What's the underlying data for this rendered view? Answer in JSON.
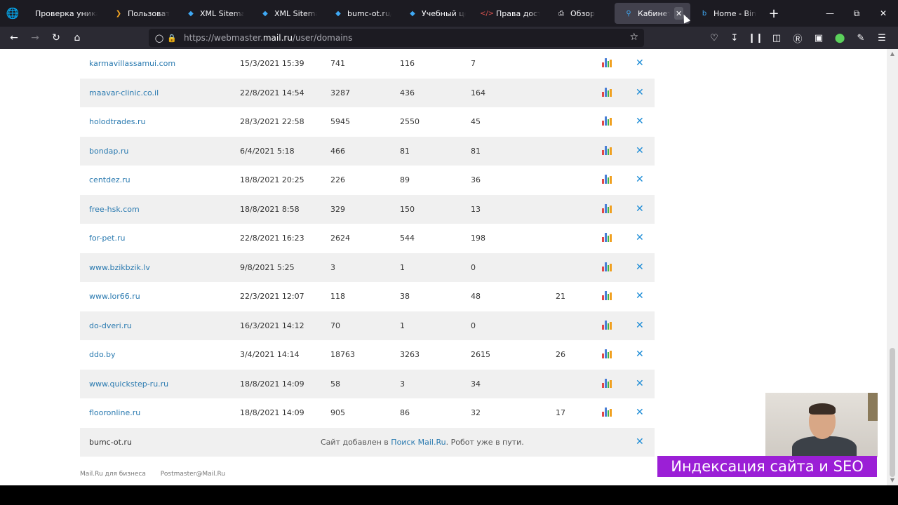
{
  "browser": {
    "tabs": [
      {
        "label": "Проверка уникаль",
        "icon": "none",
        "color": "#fbfbfe"
      },
      {
        "label": "Пользователи",
        "icon": "chevron-icon",
        "color": "#f5a623"
      },
      {
        "label": "XML Sitemap",
        "icon": "layers-icon",
        "color": "#3fa9f5"
      },
      {
        "label": "XML Sitemap",
        "icon": "layers-icon",
        "color": "#3fa9f5"
      },
      {
        "label": "bumc-ot.ru/rob",
        "icon": "layers-icon",
        "color": "#3fa9f5"
      },
      {
        "label": "Учебный центр",
        "icon": "layers-icon",
        "color": "#3fa9f5"
      },
      {
        "label": "Права доступа",
        "icon": "code-icon",
        "color": "#d9534f"
      },
      {
        "label": "Обзор",
        "icon": "printer-icon",
        "color": "#fbfbfe"
      },
      {
        "label": "Кабинет ве",
        "icon": "search-icon",
        "color": "#3fa9f5",
        "active": true
      },
      {
        "label": "Home - Bing W",
        "icon": "bing-icon",
        "color": "#3fa9f5"
      }
    ],
    "url_prefix": "https://webmaster.",
    "url_host": "mail.ru",
    "url_path": "/user/domains"
  },
  "domains": [
    {
      "domain": "karmavillassamui.com",
      "date": "15/3/2021 15:39",
      "c1": "741",
      "c2": "116",
      "c3": "7",
      "c4": ""
    },
    {
      "domain": "maavar-clinic.co.il",
      "date": "22/8/2021 14:54",
      "c1": "3287",
      "c2": "436",
      "c3": "164",
      "c4": ""
    },
    {
      "domain": "holodtrades.ru",
      "date": "28/3/2021 22:58",
      "c1": "5945",
      "c2": "2550",
      "c3": "45",
      "c4": ""
    },
    {
      "domain": "bondap.ru",
      "date": "6/4/2021 5:18",
      "c1": "466",
      "c2": "81",
      "c3": "81",
      "c4": ""
    },
    {
      "domain": "centdez.ru",
      "date": "18/8/2021 20:25",
      "c1": "226",
      "c2": "89",
      "c3": "36",
      "c4": ""
    },
    {
      "domain": "free-hsk.com",
      "date": "18/8/2021 8:58",
      "c1": "329",
      "c2": "150",
      "c3": "13",
      "c4": ""
    },
    {
      "domain": "for-pet.ru",
      "date": "22/8/2021 16:23",
      "c1": "2624",
      "c2": "544",
      "c3": "198",
      "c4": ""
    },
    {
      "domain": "www.bzikbzik.lv",
      "date": "9/8/2021 5:25",
      "c1": "3",
      "c2": "1",
      "c3": "0",
      "c4": ""
    },
    {
      "domain": "www.lor66.ru",
      "date": "22/3/2021 12:07",
      "c1": "118",
      "c2": "38",
      "c3": "48",
      "c4": "21"
    },
    {
      "domain": "do-dveri.ru",
      "date": "16/3/2021 14:12",
      "c1": "70",
      "c2": "1",
      "c3": "0",
      "c4": ""
    },
    {
      "domain": "ddo.by",
      "date": "3/4/2021 14:14",
      "c1": "18763",
      "c2": "3263",
      "c3": "2615",
      "c4": "26"
    },
    {
      "domain": "www.quickstep-ru.ru",
      "date": "18/8/2021 14:09",
      "c1": "58",
      "c2": "3",
      "c3": "34",
      "c4": ""
    },
    {
      "domain": "flooronline.ru",
      "date": "18/8/2021 14:09",
      "c1": "905",
      "c2": "86",
      "c3": "32",
      "c4": "17"
    }
  ],
  "pending": {
    "domain": "bumc-ot.ru",
    "msg_before": "Сайт добавлен в ",
    "msg_link": "Поиск Mail.Ru",
    "msg_after": ". Робот уже в пути."
  },
  "footer": {
    "link1": "Mail.Ru для бизнеса",
    "link2": "Postmaster@Mail.Ru"
  },
  "overlay": {
    "caption": "Индексация сайта и SEO"
  },
  "colors": {
    "link": "#2a7ab0",
    "delete": "#1a8bd6",
    "caption_bg": "#9b1fd6"
  }
}
